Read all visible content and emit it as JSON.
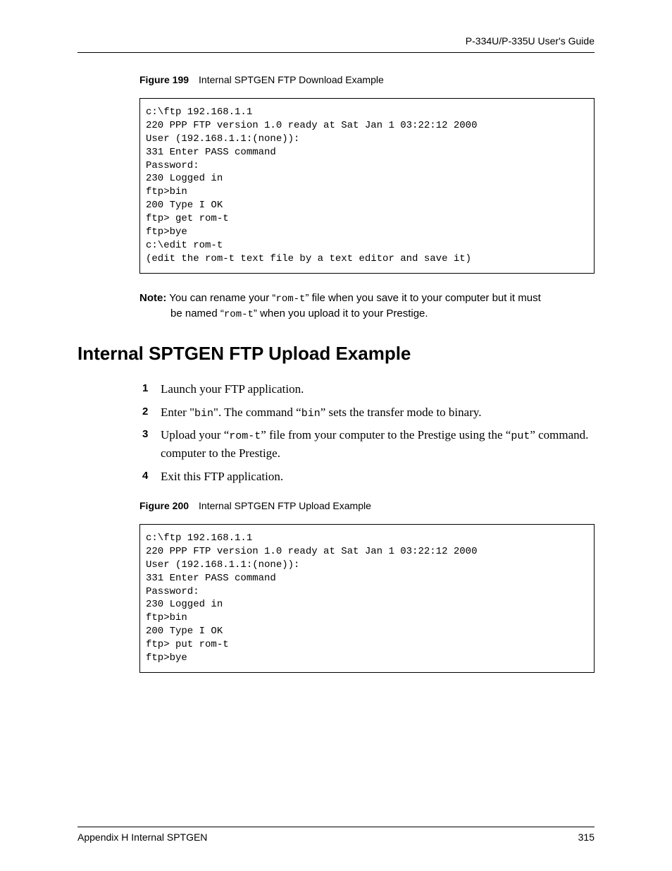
{
  "header": {
    "guide_title": "P-334U/P-335U User's Guide"
  },
  "figure199": {
    "label": "Figure 199",
    "title": "Internal SPTGEN FTP Download Example",
    "code": "c:\\ftp 192.168.1.1\n220 PPP FTP version 1.0 ready at Sat Jan 1 03:22:12 2000\nUser (192.168.1.1:(none)):\n331 Enter PASS command\nPassword:\n230 Logged in\nftp>bin\n200 Type I OK\nftp> get rom-t\nftp>bye\nc:\\edit rom-t\n(edit the rom-t text file by a text editor and save it)"
  },
  "note": {
    "label": "Note:",
    "part1": " You can rename your “",
    "mono1": "rom-t",
    "part2": "” file when you save it to your computer but it must",
    "cont1": "be named “",
    "mono2": "rom-t",
    "cont2": "” when you upload it to your Prestige."
  },
  "section_heading": "Internal SPTGEN FTP Upload Example",
  "steps": {
    "s1": {
      "num": "1",
      "text": "Launch your FTP application."
    },
    "s2": {
      "num": "2",
      "p1": "Enter \"",
      "m1": "bin",
      "p2": "\". The command “",
      "m2": "bin",
      "p3": "” sets the transfer mode to binary."
    },
    "s3": {
      "num": "3",
      "p1": "Upload your “",
      "m1": "rom-t",
      "p2": "” file from your computer to the Prestige using the “",
      "m2": "put",
      "p3": "” command.",
      "line2": "computer to the Prestige."
    },
    "s4": {
      "num": "4",
      "text": "Exit this FTP application."
    }
  },
  "figure200": {
    "label": "Figure 200",
    "title": "Internal SPTGEN FTP Upload Example",
    "code": "c:\\ftp 192.168.1.1\n220 PPP FTP version 1.0 ready at Sat Jan 1 03:22:12 2000\nUser (192.168.1.1:(none)):\n331 Enter PASS command\nPassword:\n230 Logged in\nftp>bin\n200 Type I OK\nftp> put rom-t\nftp>bye"
  },
  "footer": {
    "left": "Appendix H Internal SPTGEN",
    "right": "315"
  }
}
